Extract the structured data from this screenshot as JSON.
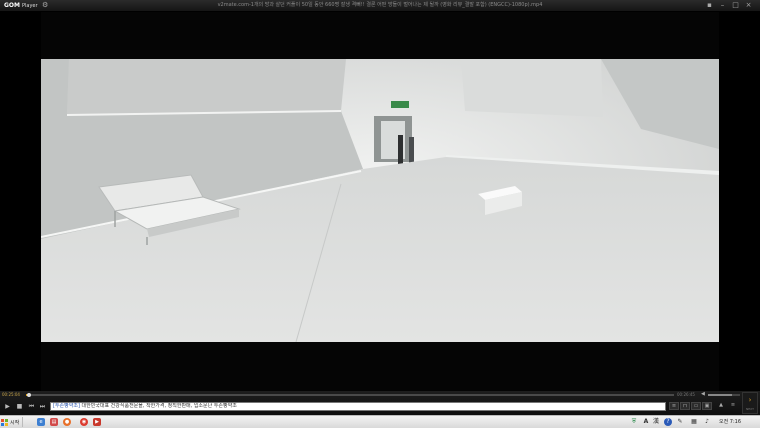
{
  "titlebar": {
    "app_logo": "GOM",
    "app_logo_sub": "Player",
    "title": "v2mate.com-1개의 방과 살던 커플이 50일 동안 660명 잘생 격뻐!! 결론 어떤 방들이 벌어나는 제 될까 (영화 리뷰_결말 포함) (ENGCC)-1080p).mp4",
    "settings_icon": "gear-icon",
    "controls": [
      "pin-icon",
      "minimize-icon",
      "maximize-icon",
      "close-icon"
    ]
  },
  "video": {
    "scene": "white-room-frame"
  },
  "controls": {
    "time_elapsed": "00:25:04",
    "time_total": "00:26:45",
    "progress": 0.004,
    "volume": 0.75,
    "ad_text_tag": "[두손빵약조]",
    "ad_text": " 대한민국대표 건강식품전문몰, 착한가격, 정직한판매, 입소문난 두손빵약조",
    "buttons": [
      "play-icon",
      "stop-icon",
      "prev-icon",
      "next-icon"
    ],
    "right_buttons": [
      "playlist-icon",
      "equalizer-icon",
      "subtitle-icon",
      "capture-icon",
      "eject-icon",
      "menu-icon"
    ],
    "next_panel_label": "NEXT"
  },
  "taskbar": {
    "start_label": "시작",
    "clock": "오전 7:16",
    "app_icons": [
      "explorer-icon",
      "browser-icon",
      "media-icon",
      "chrome-icon",
      "video-icon",
      "document-icon"
    ],
    "tray_icons": [
      "security-icon",
      "ime-a-icon",
      "ime-han-icon",
      "help-icon",
      "pen-icon",
      "network-icon",
      "speaker-icon"
    ],
    "ime_a": "A",
    "ime_han": "漢",
    "help": "?"
  },
  "colors": {
    "accent": "#d8a020",
    "start_flag": [
      "#e8502a",
      "#6bb32a",
      "#2a7ad8",
      "#f0b81c"
    ]
  }
}
